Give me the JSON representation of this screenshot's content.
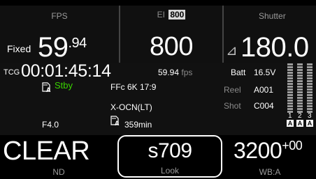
{
  "top": {
    "fps": {
      "label": "FPS",
      "mode": "Fixed",
      "whole": "59",
      "frac": ".94"
    },
    "ei": {
      "label": "EI",
      "badge": "800",
      "value": "800"
    },
    "shutter": {
      "label": "Shutter",
      "symbol": "⊿",
      "value": "180.0"
    }
  },
  "mid": {
    "tcg_label": "TCG",
    "timecode": "00:01:45:14",
    "tc_rate": "59.94",
    "tc_rate_unit": "fps",
    "rec_status": "Stby",
    "card_slot": "A",
    "format": "FFc 6K 17:9",
    "codec": "X-OCN(LT)",
    "remaining": "359min",
    "iris": "F4.0",
    "batt_label": "Batt",
    "batt_value": "16.5V",
    "reel_label": "Reel",
    "reel_value": "A001",
    "shot_label": "Shot",
    "shot_value": "C004"
  },
  "meters": {
    "channels": [
      "1",
      "2",
      "3"
    ],
    "source": [
      "A",
      "A",
      "A"
    ],
    "levels": [
      0,
      0,
      0
    ]
  },
  "bottom": {
    "nd": {
      "value": "CLEAR",
      "label": "ND"
    },
    "look": {
      "value": "s709",
      "label": "Look"
    },
    "wb": {
      "value": "3200",
      "sup": "+00",
      "label": "WB:A"
    }
  },
  "colors": {
    "bg": "#000000",
    "panel": "#101010",
    "standby": "#39d400",
    "highlight_border": "#ffffff"
  }
}
